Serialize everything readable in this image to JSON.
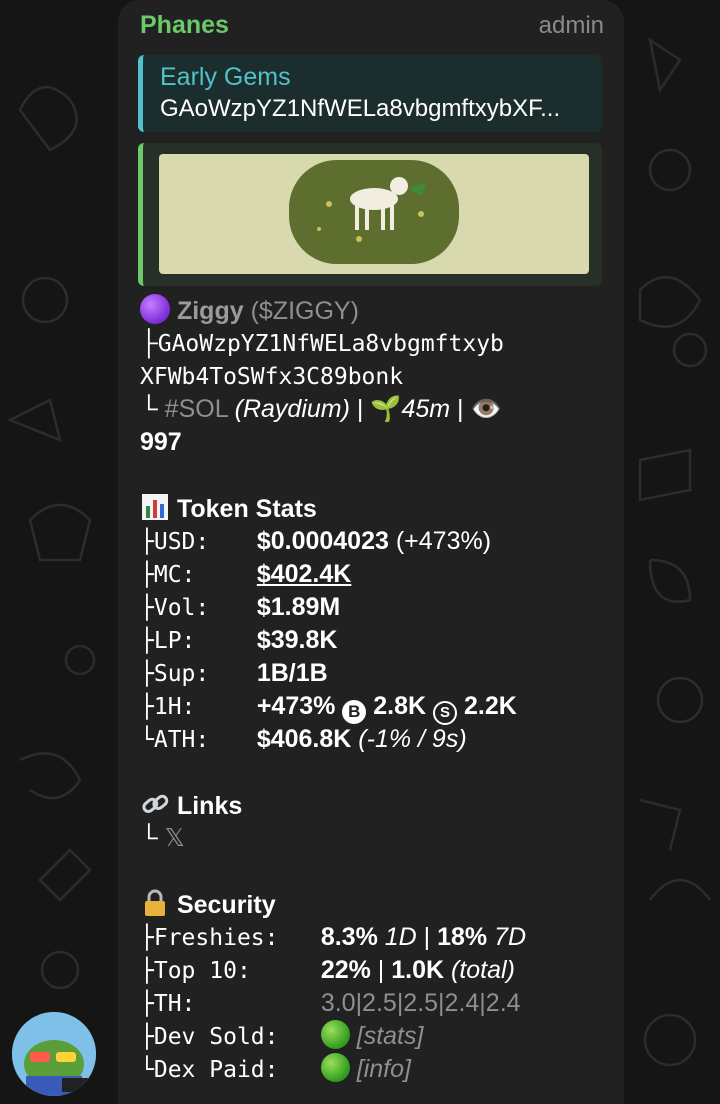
{
  "chat": {
    "sender": "Phanes",
    "role": "admin"
  },
  "reply": {
    "title": "Early Gems",
    "text": "GAoWzpYZ1NfWELa8vbgmftxybXF..."
  },
  "token": {
    "name": "Ziggy",
    "ticker": "($ZIGGY)",
    "address_line1": "GAoWzpYZ1NfWELa8vbgmftxyb",
    "address_line2": "XFWb4ToSWfx3C89bonk",
    "chain": "#SOL",
    "dex": "(Raydium)",
    "age": "45m",
    "views": "997",
    "sep": " | "
  },
  "stats": {
    "heading": "Token Stats",
    "usd_label": "USD:",
    "usd_value": "$0.0004023",
    "usd_change": " (+473%)",
    "mc_label": "MC:",
    "mc_value": "$402.4K",
    "vol_label": "Vol:",
    "vol_value": "$1.89M",
    "lp_label": "LP:",
    "lp_value": "$39.8K",
    "sup_label": "Sup:",
    "sup_value": "1B/1B",
    "h1_label": "1H:",
    "h1_change": "+473%",
    "buy_icon": "B",
    "h1_buys": "2.8K",
    "sell_icon": "S",
    "h1_sells": "2.2K",
    "ath_label": "ATH:",
    "ath_value": "$406.8K",
    "ath_note": " (-1% / 9s)"
  },
  "links": {
    "heading": "Links",
    "x_link": "𝕏"
  },
  "security": {
    "heading": "Security",
    "freshies_label": "Freshies:",
    "freshies_1d": "8.3%",
    "freshies_1d_unit": " 1D",
    "freshies_7d": "18%",
    "freshies_7d_unit": " 7D",
    "top10_label": "Top 10:",
    "top10_pct": "22%",
    "top10_total": "1.0K",
    "top10_note": " (total)",
    "th_label": "TH:",
    "th_values": "3.0|2.5|2.5|2.4|2.4",
    "devsold_label": "Dev Sold:",
    "devsold_link": "[stats]",
    "dexpaid_label": "Dex Paid:",
    "dexpaid_link": "[info]"
  },
  "colors": {
    "sender_green": "#6cc96a",
    "reply_accent": "#4fc3c9",
    "bubble_bg": "#212121",
    "background": "#151515"
  }
}
